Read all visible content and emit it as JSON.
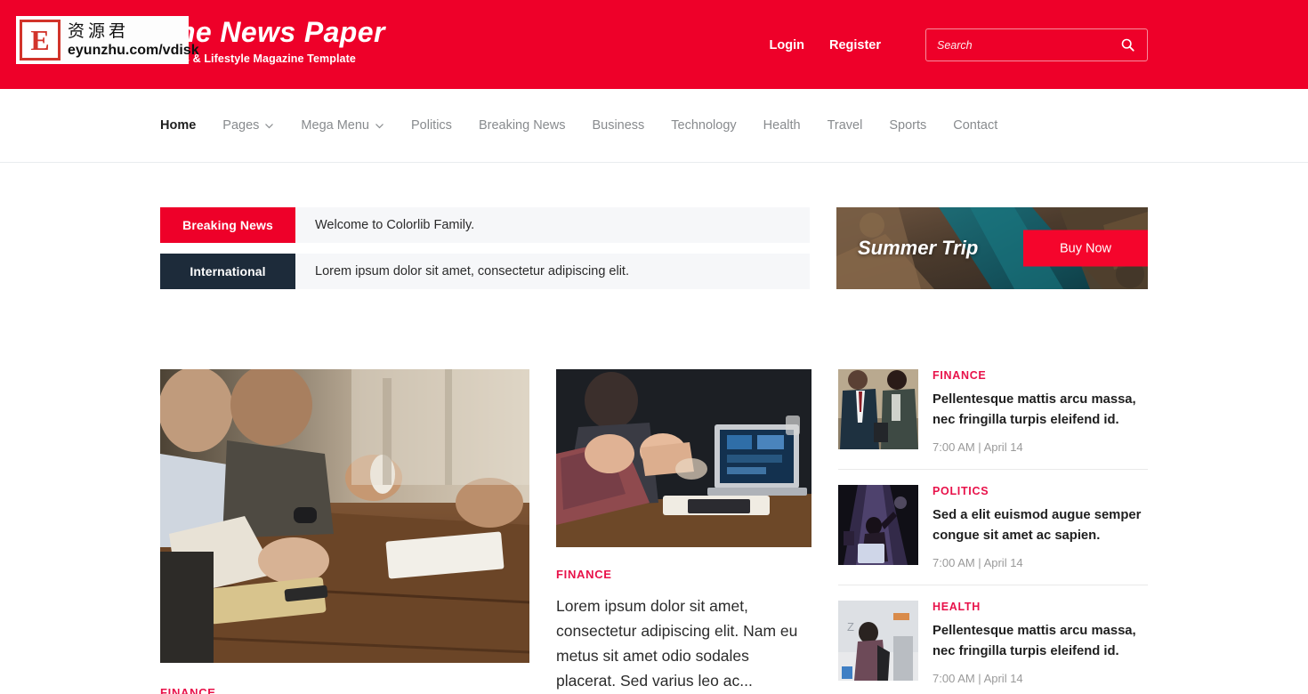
{
  "header": {
    "brand_title": "The News Paper",
    "brand_subtitle": "News & Lifestyle Magazine Template",
    "login_label": "Login",
    "register_label": "Register",
    "search_placeholder": "Search",
    "search_value": "",
    "background_color": "#ee0029"
  },
  "nav": {
    "items": [
      {
        "label": "Home",
        "has_dropdown": false,
        "active": true
      },
      {
        "label": "Pages",
        "has_dropdown": true,
        "active": false
      },
      {
        "label": "Mega Menu",
        "has_dropdown": true,
        "active": false
      },
      {
        "label": "Politics",
        "has_dropdown": false,
        "active": false
      },
      {
        "label": "Breaking News",
        "has_dropdown": false,
        "active": false
      },
      {
        "label": "Business",
        "has_dropdown": false,
        "active": false
      },
      {
        "label": "Technology",
        "has_dropdown": false,
        "active": false
      },
      {
        "label": "Health",
        "has_dropdown": false,
        "active": false
      },
      {
        "label": "Travel",
        "has_dropdown": false,
        "active": false
      },
      {
        "label": "Sports",
        "has_dropdown": false,
        "active": false
      },
      {
        "label": "Contact",
        "has_dropdown": false,
        "active": false
      }
    ]
  },
  "ticker": {
    "rows": [
      {
        "badge": "Breaking News",
        "badge_color": "#ee0029",
        "text": "Welcome to Colorlib Family."
      },
      {
        "badge": "International",
        "badge_color": "#1d2b3a",
        "text": "Lorem ipsum dolor sit amet, consectetur adipiscing elit."
      }
    ]
  },
  "ad": {
    "title": "Summer Trip",
    "button_label": "Buy Now",
    "button_color": "#f5052c"
  },
  "featured": {
    "category": "FINANCE"
  },
  "middle_article": {
    "category": "FINANCE",
    "excerpt": "Lorem ipsum dolor sit amet, consectetur adipiscing elit. Nam eu metus sit amet odio sodales placerat. Sed varius leo ac..."
  },
  "sidebar": {
    "items": [
      {
        "category": "FINANCE",
        "title": "Pellentesque mattis arcu massa, nec fringilla turpis eleifend id.",
        "date": "7:00 AM | April 14"
      },
      {
        "category": "POLITICS",
        "title": "Sed a elit euismod augue semper congue sit amet ac sapien.",
        "date": "7:00 AM | April 14"
      },
      {
        "category": "HEALTH",
        "title": "Pellentesque mattis arcu massa, nec fringilla turpis eleifend id.",
        "date": "7:00 AM | April 14"
      }
    ]
  },
  "watermark": {
    "logo_letter": "E",
    "chinese_text": "资源君",
    "url_text": "eyunzhu.com/vdisk"
  }
}
